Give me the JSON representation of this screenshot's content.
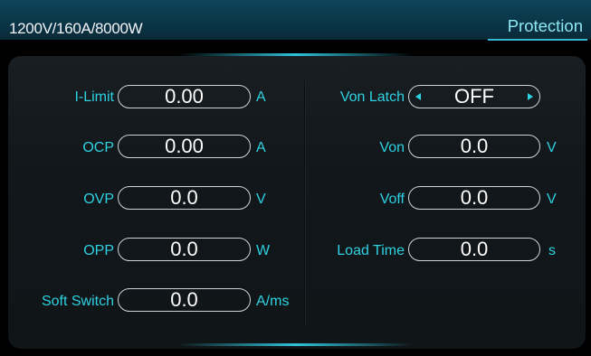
{
  "header": {
    "model": "1200V/160A/8000W",
    "page_title": "Protection"
  },
  "left_params": [
    {
      "label": "I-Limit",
      "value": "0.00",
      "unit": "A"
    },
    {
      "label": "OCP",
      "value": "0.00",
      "unit": "A"
    },
    {
      "label": "OVP",
      "value": "0.0",
      "unit": "V"
    },
    {
      "label": "OPP",
      "value": "0.0",
      "unit": "W"
    },
    {
      "label": "Soft Switch",
      "value": "0.0",
      "unit": "A/ms"
    }
  ],
  "right_params": [
    {
      "label": "Von Latch",
      "value": "OFF"
    },
    {
      "label": "Von",
      "value": "0.0",
      "unit": "V"
    },
    {
      "label": "Voff",
      "value": "0.0",
      "unit": "V"
    },
    {
      "label": "Load Time",
      "value": "0.0",
      "unit": "s"
    }
  ],
  "colors": {
    "accent": "#2ed2e2",
    "header_bg": "#0a3244",
    "panel_bg": "#151b1f"
  },
  "icons": {
    "latch_prev": "chevron-left-icon",
    "latch_next": "chevron-right-icon"
  }
}
